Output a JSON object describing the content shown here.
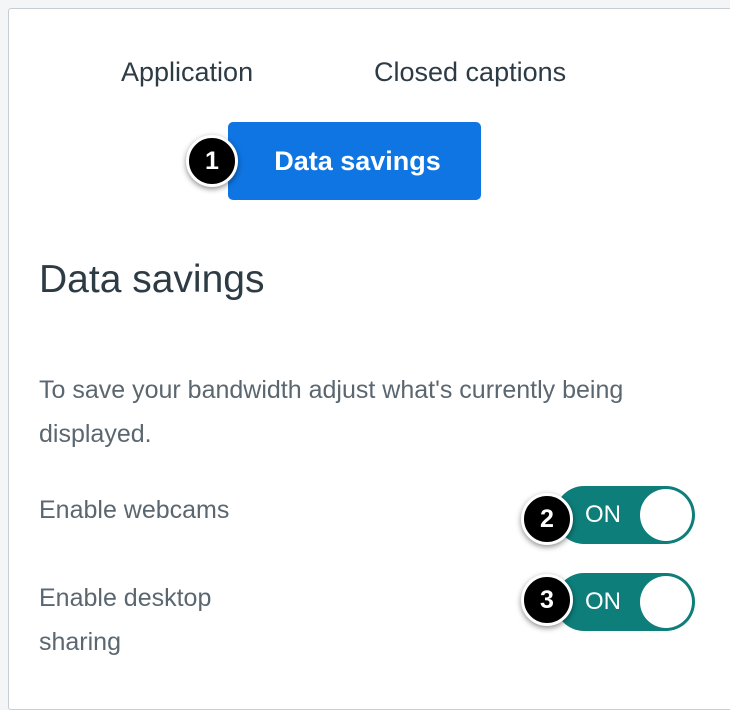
{
  "tabs": [
    {
      "label": "Application"
    },
    {
      "label": "Closed captions"
    },
    {
      "label": "Data savings",
      "active": true
    }
  ],
  "section": {
    "title": "Data savings",
    "description": "To save your bandwidth adjust what's currently being displayed."
  },
  "settings": [
    {
      "label": "Enable webcams",
      "state": "ON"
    },
    {
      "label": "Enable desktop sharing",
      "state": "ON"
    }
  ],
  "callouts": [
    "1",
    "2",
    "3"
  ],
  "colors": {
    "active_tab": "#0e75e3",
    "toggle_on": "#0d7e7a",
    "text": "#2d3b45",
    "muted_text": "#5b6770"
  }
}
